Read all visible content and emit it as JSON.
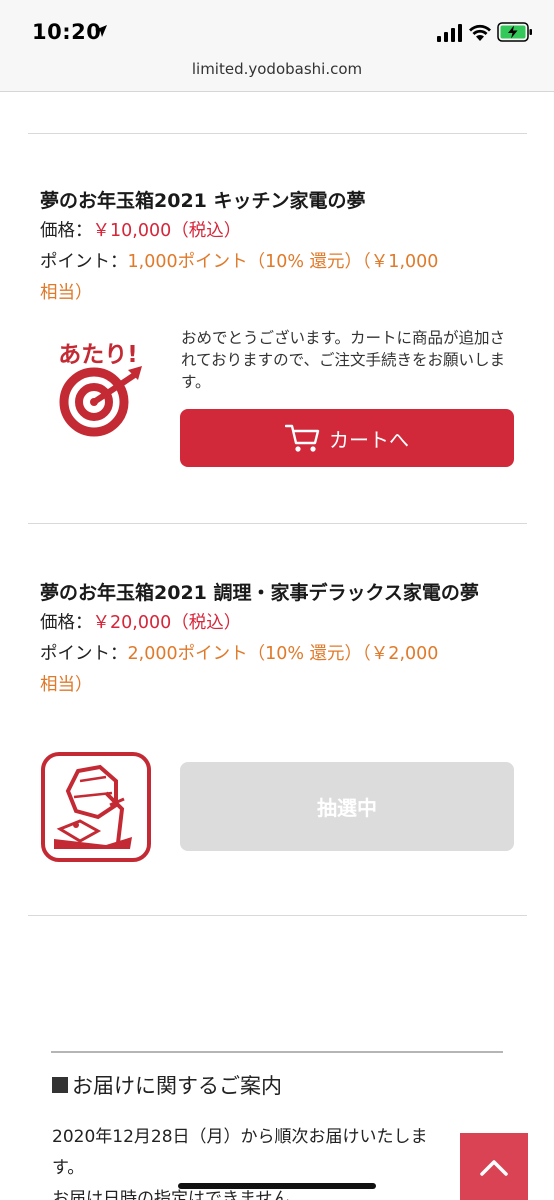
{
  "status_bar": {
    "time": "10:20",
    "url": "limited.yodobashi.com"
  },
  "products": [
    {
      "title": "夢のお年玉箱2021 キッチン家電の夢",
      "price_label": "価格：",
      "price_value": "￥10,000（税込）",
      "point_label": "ポイント：",
      "point_value": "1,000ポイント（10% 還元）（￥1,000",
      "point_cont": "相当）",
      "badge_text": "あたり!",
      "message": "おめでとうございます。カートに商品が追加されておりますので、ご注文手続きをお願いします。",
      "button_label": "カートへ"
    },
    {
      "title": "夢のお年玉箱2021 調理・家事デラックス家電の夢",
      "price_label": "価格：",
      "price_value": "￥20,000（税込）",
      "point_label": "ポイント：",
      "point_value": "2,000ポイント（10% 還元）（￥2,000",
      "point_cont": "相当）",
      "button_label": "抽選中"
    }
  ],
  "delivery": {
    "heading": "お届けに関するご案内",
    "line1": "2020年12月28日（月）から順次お届けいたしま",
    "line2": "す。",
    "line3": "お届け日時の指定はできません。"
  },
  "colors": {
    "accent": "#d1293a",
    "point": "#e07a2b",
    "disabled": "#dcdcdc"
  },
  "icons": [
    "location-arrow-icon",
    "signal-icon",
    "wifi-icon",
    "battery-charging-icon",
    "cart-icon",
    "atari-target-icon",
    "lottery-machine-icon",
    "chevron-up-icon"
  ]
}
